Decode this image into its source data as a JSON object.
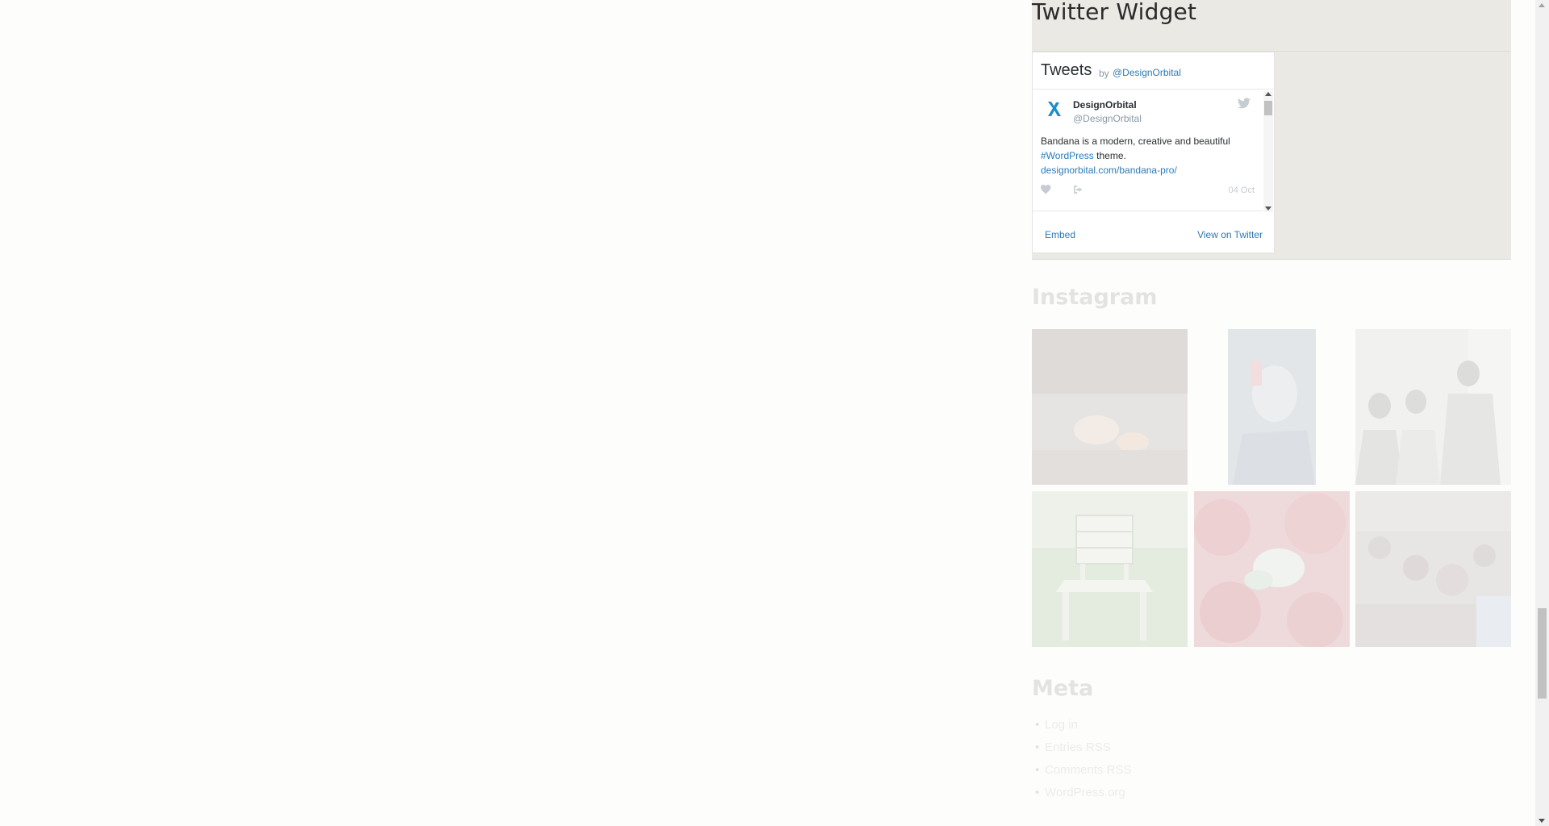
{
  "twitter_widget": {
    "title": "Twitter Widget",
    "timeline": {
      "heading": "Tweets",
      "by": "by",
      "handle_link": "@DesignOrbital",
      "tweet": {
        "avatar": "designorbital-logo",
        "name": "DesignOrbital",
        "screen_name": "@DesignOrbital",
        "text_before": "Bandana is a modern, creative and beautiful",
        "hashtag": "#WordPress",
        "text_after": "theme.",
        "link": "designorbital.com/bandana-pro/",
        "date": "04 Oct",
        "icons": {
          "bird": "twitter-bird-icon",
          "like": "heart-icon",
          "share": "share-icon"
        }
      },
      "footer": {
        "embed": "Embed",
        "view": "View on Twitter"
      }
    }
  },
  "instagram": {
    "title": "Instagram",
    "images": [
      {
        "name": "instagram-photo-fire"
      },
      {
        "name": "instagram-photo-portrait"
      },
      {
        "name": "instagram-photo-group"
      },
      {
        "name": "instagram-photo-chair"
      },
      {
        "name": "instagram-photo-roses"
      },
      {
        "name": "instagram-photo-crowd"
      }
    ]
  },
  "meta": {
    "title": "Meta",
    "items": [
      "Log in",
      "Entries RSS",
      "Comments RSS",
      "WordPress.org"
    ]
  },
  "colors": {
    "page_background": "#fdfdfb",
    "widget_background": "#ebe9e4",
    "twitter_link": "#2b7bb9",
    "faded_text": "#e3e3e0"
  }
}
